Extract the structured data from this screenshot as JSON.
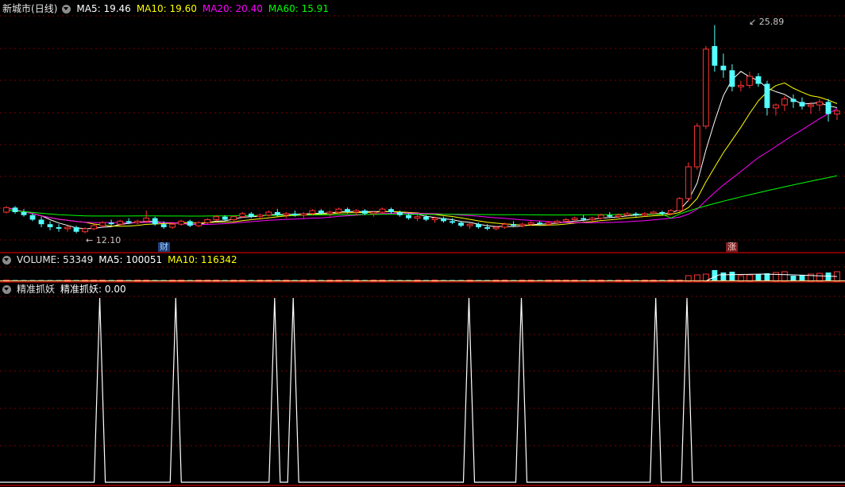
{
  "main": {
    "stock_name": "新城市",
    "period": "(日线)",
    "ma5_label": "MA5: 19.46",
    "ma10_label": "MA10: 19.60",
    "ma20_label": "MA20: 20.40",
    "ma60_label": "MA60: 15.91",
    "high_annotation": "25.89",
    "low_annotation": "12.10",
    "cai_badge": "财",
    "zhang_badge": "涨"
  },
  "volume": {
    "label": "VOLUME: 53349",
    "ma5_label": "MA5: 100051",
    "ma10_label": "MA10: 116342"
  },
  "indicator": {
    "name": "精准抓妖",
    "value_label": "精准抓妖: 0.00"
  },
  "colors": {
    "up": "#ff3232",
    "down": "#54ffff",
    "ma5": "#ffffff",
    "ma10": "#ffff00",
    "ma20": "#ff00ff",
    "ma60": "#00ff00",
    "grid": "#7a0000",
    "separator": "#aa0000"
  },
  "chart_data": {
    "type": "candlestick",
    "price_range": [
      11.5,
      26.5
    ],
    "high": 25.89,
    "low": 12.1,
    "candles": [
      [
        13.5,
        13.9,
        13.4,
        13.8
      ],
      [
        13.8,
        13.9,
        13.4,
        13.5
      ],
      [
        13.5,
        13.7,
        13.2,
        13.3
      ],
      [
        13.3,
        13.4,
        12.9,
        13.0
      ],
      [
        13.0,
        13.2,
        12.5,
        12.7
      ],
      [
        12.7,
        12.9,
        12.3,
        12.5
      ],
      [
        12.5,
        12.7,
        12.2,
        12.4
      ],
      [
        12.4,
        12.6,
        12.2,
        12.5
      ],
      [
        12.5,
        12.6,
        12.1,
        12.2
      ],
      [
        12.2,
        12.5,
        12.1,
        12.4
      ],
      [
        12.4,
        12.7,
        12.3,
        12.6
      ],
      [
        12.6,
        12.9,
        12.5,
        12.8
      ],
      [
        12.8,
        13.0,
        12.6,
        12.7
      ],
      [
        12.7,
        13.0,
        12.6,
        12.9
      ],
      [
        12.9,
        13.1,
        12.7,
        12.8
      ],
      [
        12.8,
        13.0,
        12.6,
        12.9
      ],
      [
        12.9,
        13.6,
        12.8,
        13.1
      ],
      [
        13.1,
        13.2,
        12.6,
        12.7
      ],
      [
        12.7,
        12.9,
        12.4,
        12.5
      ],
      [
        12.5,
        12.8,
        12.4,
        12.7
      ],
      [
        12.7,
        13.0,
        12.6,
        12.9
      ],
      [
        12.9,
        13.0,
        12.5,
        12.6
      ],
      [
        12.6,
        12.9,
        12.5,
        12.8
      ],
      [
        12.8,
        13.1,
        12.7,
        13.0
      ],
      [
        13.0,
        13.3,
        12.9,
        13.2
      ],
      [
        13.2,
        13.3,
        12.9,
        13.0
      ],
      [
        13.0,
        13.3,
        12.9,
        13.2
      ],
      [
        13.2,
        13.5,
        13.1,
        13.4
      ],
      [
        13.4,
        13.5,
        13.1,
        13.2
      ],
      [
        13.2,
        13.4,
        13.0,
        13.3
      ],
      [
        13.3,
        13.6,
        13.2,
        13.5
      ],
      [
        13.5,
        13.7,
        13.2,
        13.3
      ],
      [
        13.3,
        13.5,
        13.1,
        13.4
      ],
      [
        13.4,
        13.6,
        13.2,
        13.3
      ],
      [
        13.3,
        13.5,
        13.1,
        13.4
      ],
      [
        13.4,
        13.7,
        13.3,
        13.6
      ],
      [
        13.6,
        13.7,
        13.3,
        13.4
      ],
      [
        13.4,
        13.6,
        13.2,
        13.5
      ],
      [
        13.5,
        13.8,
        13.4,
        13.7
      ],
      [
        13.7,
        13.8,
        13.4,
        13.5
      ],
      [
        13.5,
        13.7,
        13.3,
        13.6
      ],
      [
        13.6,
        13.7,
        13.3,
        13.4
      ],
      [
        13.4,
        13.6,
        13.2,
        13.5
      ],
      [
        13.5,
        13.8,
        13.4,
        13.7
      ],
      [
        13.7,
        13.8,
        13.4,
        13.5
      ],
      [
        13.5,
        13.6,
        13.2,
        13.3
      ],
      [
        13.3,
        13.4,
        13.0,
        13.1
      ],
      [
        13.1,
        13.3,
        12.9,
        13.2
      ],
      [
        13.2,
        13.3,
        12.9,
        13.0
      ],
      [
        13.0,
        13.2,
        12.8,
        13.1
      ],
      [
        13.1,
        13.2,
        12.8,
        12.9
      ],
      [
        12.9,
        13.1,
        12.7,
        12.8
      ],
      [
        12.8,
        12.9,
        12.5,
        12.6
      ],
      [
        12.6,
        12.8,
        12.4,
        12.7
      ],
      [
        12.7,
        12.8,
        12.4,
        12.5
      ],
      [
        12.5,
        12.7,
        12.3,
        12.4
      ],
      [
        12.4,
        12.6,
        12.3,
        12.5
      ],
      [
        12.5,
        12.8,
        12.4,
        12.7
      ],
      [
        12.7,
        12.9,
        12.5,
        12.6
      ],
      [
        12.6,
        12.8,
        12.5,
        12.7
      ],
      [
        12.7,
        12.9,
        12.6,
        12.8
      ],
      [
        12.8,
        12.9,
        12.6,
        12.7
      ],
      [
        12.7,
        12.9,
        12.6,
        12.8
      ],
      [
        12.8,
        13.0,
        12.7,
        12.9
      ],
      [
        12.9,
        13.1,
        12.8,
        13.0
      ],
      [
        13.0,
        13.2,
        12.9,
        13.1
      ],
      [
        13.1,
        13.3,
        12.9,
        13.0
      ],
      [
        13.0,
        13.2,
        12.9,
        13.1
      ],
      [
        13.1,
        13.4,
        13.0,
        13.3
      ],
      [
        13.3,
        13.5,
        13.1,
        13.2
      ],
      [
        13.2,
        13.4,
        13.1,
        13.3
      ],
      [
        13.3,
        13.5,
        13.2,
        13.4
      ],
      [
        13.4,
        13.5,
        13.2,
        13.3
      ],
      [
        13.3,
        13.5,
        13.2,
        13.4
      ],
      [
        13.4,
        13.6,
        13.3,
        13.5
      ],
      [
        13.5,
        13.6,
        13.3,
        13.4
      ],
      [
        13.4,
        13.7,
        13.3,
        13.6
      ],
      [
        13.6,
        14.5,
        13.5,
        14.4
      ],
      [
        14.4,
        16.8,
        14.2,
        16.5
      ],
      [
        16.5,
        19.4,
        16.3,
        19.2
      ],
      [
        19.2,
        24.5,
        19.0,
        24.3
      ],
      [
        24.5,
        25.89,
        22.8,
        23.2
      ],
      [
        23.2,
        24.0,
        22.4,
        22.9
      ],
      [
        22.9,
        23.3,
        21.5,
        21.8
      ],
      [
        21.8,
        22.2,
        21.5,
        21.9
      ],
      [
        21.9,
        22.8,
        21.7,
        22.5
      ],
      [
        22.5,
        22.7,
        21.8,
        22.0
      ],
      [
        22.0,
        22.2,
        19.9,
        20.4
      ],
      [
        20.4,
        20.7,
        19.9,
        20.6
      ],
      [
        20.6,
        21.2,
        20.2,
        21.0
      ],
      [
        21.0,
        21.3,
        20.4,
        20.8
      ],
      [
        20.8,
        21.1,
        20.3,
        20.5
      ],
      [
        20.5,
        20.8,
        20.0,
        20.6
      ],
      [
        20.6,
        21.0,
        20.2,
        20.8
      ],
      [
        20.8,
        21.0,
        19.5,
        20.0
      ],
      [
        20.0,
        20.3,
        19.6,
        20.2
      ]
    ],
    "ma60_end": 15.91,
    "spike_positions": [
      0.118,
      0.208,
      0.325,
      0.347,
      0.555,
      0.617,
      0.776,
      0.813
    ]
  }
}
